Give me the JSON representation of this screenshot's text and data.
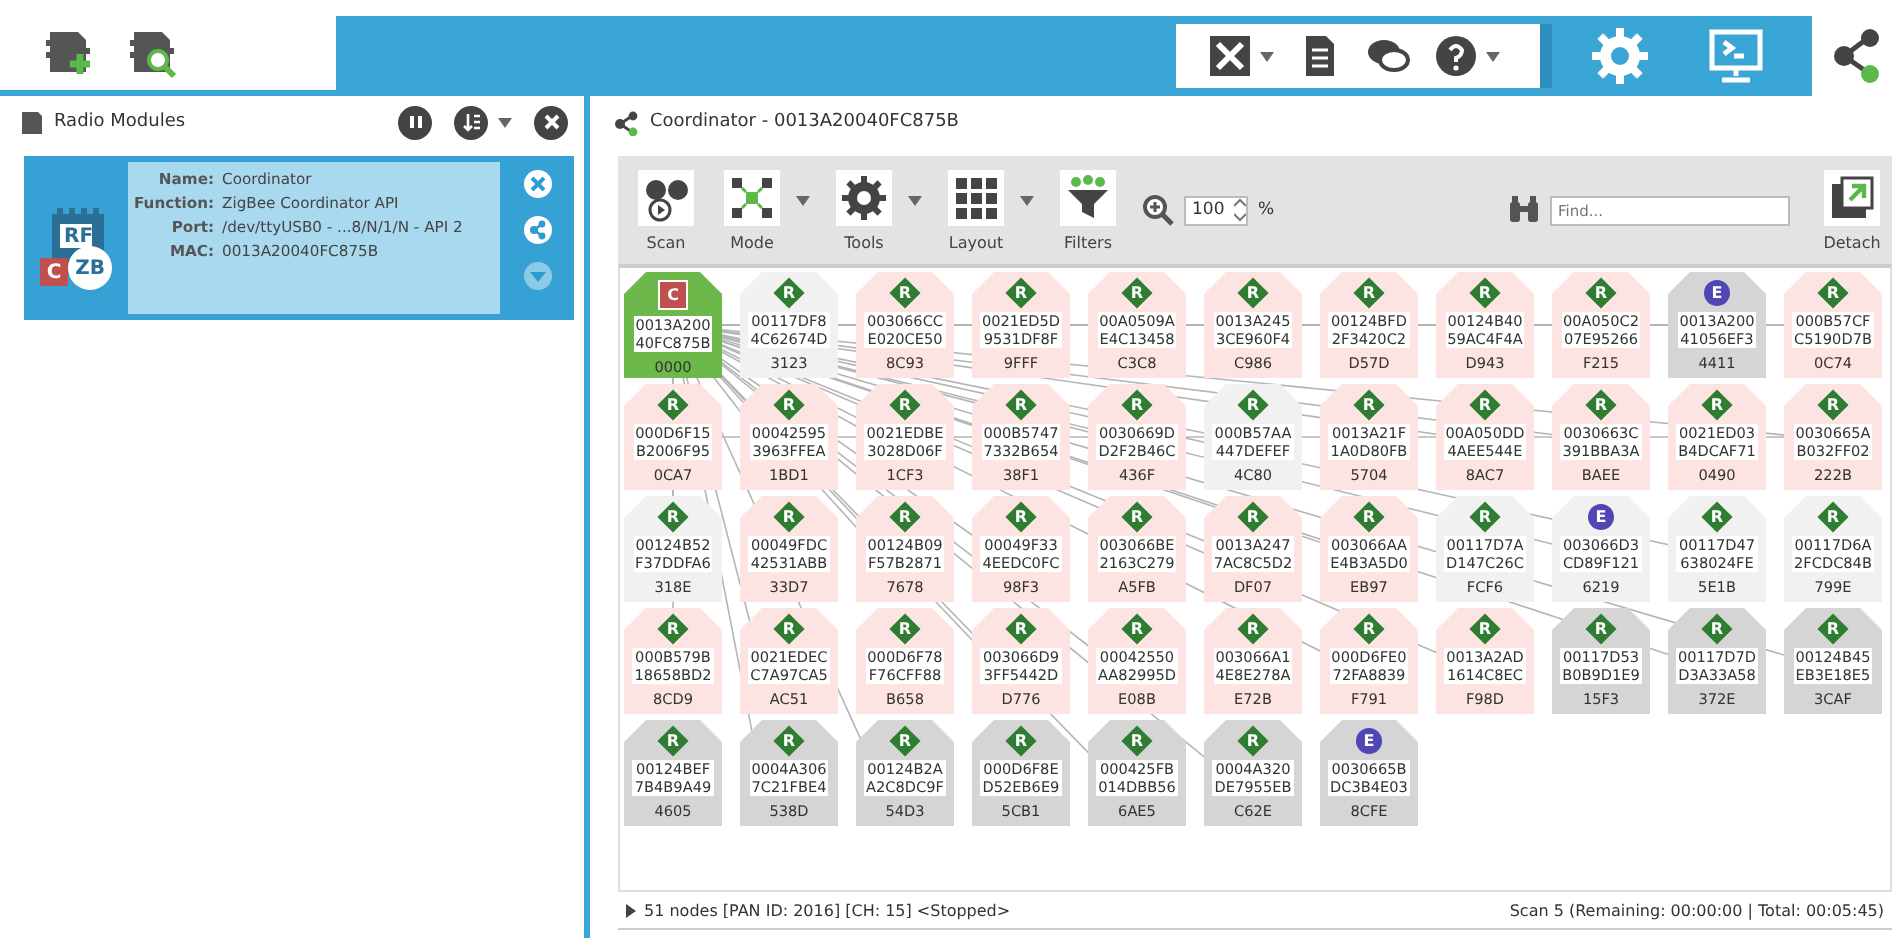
{
  "top_bar": {
    "module_buttons": [
      {
        "kind": "add"
      },
      {
        "kind": "discover"
      }
    ],
    "tools": [
      {
        "kind": "tools",
        "dropdown": true
      },
      {
        "kind": "document",
        "dropdown": false
      },
      {
        "kind": "chat",
        "dropdown": false
      },
      {
        "kind": "help",
        "dropdown": true
      }
    ],
    "modes": [
      {
        "kind": "configuration",
        "selected": false
      },
      {
        "kind": "console",
        "selected": false
      },
      {
        "kind": "network",
        "selected": true
      }
    ]
  },
  "radio_modules": {
    "title": "Radio Modules",
    "modules": [
      {
        "selected": true,
        "icon_text": "RF",
        "role": "C",
        "protocol": "ZB",
        "fields": [
          {
            "label": "Name:",
            "value": "Coordinator"
          },
          {
            "label": "Function:",
            "value": "ZigBee Coordinator API"
          },
          {
            "label": "Port:",
            "value": "/dev/ttyUSB0 - ...8/N/1/N - API 2"
          },
          {
            "label": "MAC:",
            "value": "0013A20040FC875B"
          }
        ],
        "actions": [
          {
            "kind": "close",
            "disabled": false
          },
          {
            "kind": "network",
            "disabled": false
          },
          {
            "kind": "expand",
            "disabled": true
          }
        ]
      }
    ]
  },
  "network": {
    "title": "Coordinator - 0013A20040FC875B",
    "toolbar": [
      {
        "kind": "scan",
        "label": "Scan",
        "dropdown": false
      },
      {
        "kind": "mode",
        "label": "Mode",
        "dropdown": true
      },
      {
        "kind": "tools",
        "label": "Tools",
        "dropdown": true
      },
      {
        "kind": "layout",
        "label": "Layout",
        "dropdown": true
      },
      {
        "kind": "filters",
        "label": "Filters",
        "dropdown": false
      }
    ],
    "zoom": {
      "value": "100",
      "unit": "%"
    },
    "find": {
      "placeholder": "Find..."
    },
    "detach": {
      "label": "Detach"
    },
    "nodes": [
      {
        "kind": "coordinator",
        "badge": "C",
        "addr": [
          "0013A200",
          "40FC875B"
        ],
        "short": "0000",
        "color": "#6cb84a"
      },
      {
        "kind": "router",
        "badge": "R",
        "addr": [
          "00117DF8",
          "4C62674D"
        ],
        "short": "3123",
        "color": "#f1f1f1"
      },
      {
        "kind": "router",
        "badge": "R",
        "addr": [
          "003066CC",
          "E020CE50"
        ],
        "short": "8C93",
        "color": "#fde3e1"
      },
      {
        "kind": "router",
        "badge": "R",
        "addr": [
          "0021ED5D",
          "9531DF8F"
        ],
        "short": "9FFF",
        "color": "#fde3e1"
      },
      {
        "kind": "router",
        "badge": "R",
        "addr": [
          "00A0509A",
          "E4C13458"
        ],
        "short": "C3C8",
        "color": "#fde3e1"
      },
      {
        "kind": "router",
        "badge": "R",
        "addr": [
          "0013A245",
          "3CE960F4"
        ],
        "short": "C986",
        "color": "#fde3e1"
      },
      {
        "kind": "router",
        "badge": "R",
        "addr": [
          "00124BFD",
          "2F3420C2"
        ],
        "short": "D57D",
        "color": "#fde3e1"
      },
      {
        "kind": "router",
        "badge": "R",
        "addr": [
          "00124B40",
          "59AC4F4A"
        ],
        "short": "D943",
        "color": "#fde3e1"
      },
      {
        "kind": "router",
        "badge": "R",
        "addr": [
          "00A050C2",
          "07E95266"
        ],
        "short": "F215",
        "color": "#fde3e1"
      },
      {
        "kind": "end_device",
        "badge": "E",
        "addr": [
          "0013A200",
          "41056EF3"
        ],
        "short": "4411",
        "color": "#d5d5d5"
      },
      {
        "kind": "router",
        "badge": "R",
        "addr": [
          "000B57CF",
          "C5190D7B"
        ],
        "short": "0C74",
        "color": "#fde3e1"
      },
      {
        "kind": "router",
        "badge": "R",
        "addr": [
          "000D6F15",
          "B2006F95"
        ],
        "short": "0CA7",
        "color": "#fde3e1"
      },
      {
        "kind": "router",
        "badge": "R",
        "addr": [
          "00042595",
          "3963FFEA"
        ],
        "short": "1BD1",
        "color": "#fde3e1"
      },
      {
        "kind": "router",
        "badge": "R",
        "addr": [
          "0021EDBE",
          "3028D06F"
        ],
        "short": "1CF3",
        "color": "#fde3e1"
      },
      {
        "kind": "router",
        "badge": "R",
        "addr": [
          "000B5747",
          "7332B654"
        ],
        "short": "38F1",
        "color": "#fde3e1"
      },
      {
        "kind": "router",
        "badge": "R",
        "addr": [
          "0030669D",
          "D2F2B46C"
        ],
        "short": "436F",
        "color": "#fde3e1"
      },
      {
        "kind": "router",
        "badge": "R",
        "addr": [
          "000B57AA",
          "447DEFEF"
        ],
        "short": "4C80",
        "color": "#f1f1f1"
      },
      {
        "kind": "router",
        "badge": "R",
        "addr": [
          "0013A21F",
          "1A0D80FB"
        ],
        "short": "5704",
        "color": "#fde3e1"
      },
      {
        "kind": "router",
        "badge": "R",
        "addr": [
          "00A050DD",
          "4AEE544E"
        ],
        "short": "8AC7",
        "color": "#fde3e1"
      },
      {
        "kind": "router",
        "badge": "R",
        "addr": [
          "0030663C",
          "391BBA3A"
        ],
        "short": "BAEE",
        "color": "#fde3e1"
      },
      {
        "kind": "router",
        "badge": "R",
        "addr": [
          "0021ED03",
          "B4DCAF71"
        ],
        "short": "0490",
        "color": "#fde3e1"
      },
      {
        "kind": "router",
        "badge": "R",
        "addr": [
          "0030665A",
          "B032FF02"
        ],
        "short": "222B",
        "color": "#fde3e1"
      },
      {
        "kind": "router",
        "badge": "R",
        "addr": [
          "00124B52",
          "F37DDFA6"
        ],
        "short": "318E",
        "color": "#f1f1f1"
      },
      {
        "kind": "router",
        "badge": "R",
        "addr": [
          "00049FDC",
          "42531ABB"
        ],
        "short": "33D7",
        "color": "#fde3e1"
      },
      {
        "kind": "router",
        "badge": "R",
        "addr": [
          "00124B09",
          "F57B2871"
        ],
        "short": "7678",
        "color": "#fde3e1"
      },
      {
        "kind": "router",
        "badge": "R",
        "addr": [
          "00049F33",
          "4EEDC0FC"
        ],
        "short": "98F3",
        "color": "#fde3e1"
      },
      {
        "kind": "router",
        "badge": "R",
        "addr": [
          "003066BE",
          "2163C279"
        ],
        "short": "A5FB",
        "color": "#fde3e1"
      },
      {
        "kind": "router",
        "badge": "R",
        "addr": [
          "0013A247",
          "7AC8C5D2"
        ],
        "short": "DF07",
        "color": "#fde3e1"
      },
      {
        "kind": "router",
        "badge": "R",
        "addr": [
          "003066AA",
          "E4B3A5D0"
        ],
        "short": "EB97",
        "color": "#fde3e1"
      },
      {
        "kind": "router",
        "badge": "R",
        "addr": [
          "00117D7A",
          "D147C26C"
        ],
        "short": "FCF6",
        "color": "#f1f1f1"
      },
      {
        "kind": "end_device",
        "badge": "E",
        "addr": [
          "003066D3",
          "CD89F121"
        ],
        "short": "6219",
        "color": "#f1f1f1"
      },
      {
        "kind": "router",
        "badge": "R",
        "addr": [
          "00117D47",
          "638024FE"
        ],
        "short": "5E1B",
        "color": "#f1f1f1"
      },
      {
        "kind": "router",
        "badge": "R",
        "addr": [
          "00117D6A",
          "2FCDC84B"
        ],
        "short": "799E",
        "color": "#f1f1f1"
      },
      {
        "kind": "router",
        "badge": "R",
        "addr": [
          "000B579B",
          "18658BD2"
        ],
        "short": "8CD9",
        "color": "#fde3e1"
      },
      {
        "kind": "router",
        "badge": "R",
        "addr": [
          "0021EDEC",
          "C7A97CA5"
        ],
        "short": "AC51",
        "color": "#fde3e1"
      },
      {
        "kind": "router",
        "badge": "R",
        "addr": [
          "000D6F78",
          "F76CFF88"
        ],
        "short": "B658",
        "color": "#fde3e1"
      },
      {
        "kind": "router",
        "badge": "R",
        "addr": [
          "003066D9",
          "3FF5442D"
        ],
        "short": "D776",
        "color": "#fde3e1"
      },
      {
        "kind": "router",
        "badge": "R",
        "addr": [
          "00042550",
          "AA82995D"
        ],
        "short": "E08B",
        "color": "#fde3e1"
      },
      {
        "kind": "router",
        "badge": "R",
        "addr": [
          "003066A1",
          "4E8E278A"
        ],
        "short": "E72B",
        "color": "#fde3e1"
      },
      {
        "kind": "router",
        "badge": "R",
        "addr": [
          "000D6FE0",
          "72FA8839"
        ],
        "short": "F791",
        "color": "#fde3e1"
      },
      {
        "kind": "router",
        "badge": "R",
        "addr": [
          "0013A2AD",
          "1614C8EC"
        ],
        "short": "F98D",
        "color": "#fde3e1"
      },
      {
        "kind": "router",
        "badge": "R",
        "addr": [
          "00117D53",
          "B0B9D1E9"
        ],
        "short": "15F3",
        "color": "#d5d5d5"
      },
      {
        "kind": "router",
        "badge": "R",
        "addr": [
          "00117D7D",
          "D3A33A58"
        ],
        "short": "372E",
        "color": "#d5d5d5"
      },
      {
        "kind": "router",
        "badge": "R",
        "addr": [
          "00124B45",
          "EB3E18E5"
        ],
        "short": "3CAF",
        "color": "#d5d5d5"
      },
      {
        "kind": "router",
        "badge": "R",
        "addr": [
          "00124BEF",
          "7B4B9A49"
        ],
        "short": "4605",
        "color": "#d5d5d5"
      },
      {
        "kind": "router",
        "badge": "R",
        "addr": [
          "0004A306",
          "7C21FBE4"
        ],
        "short": "538D",
        "color": "#d5d5d5"
      },
      {
        "kind": "router",
        "badge": "R",
        "addr": [
          "00124B2A",
          "A2C8DC9F"
        ],
        "short": "54D3",
        "color": "#d5d5d5"
      },
      {
        "kind": "router",
        "badge": "R",
        "addr": [
          "000D6F8E",
          "D52EB6E9"
        ],
        "short": "5CB1",
        "color": "#d5d5d5"
      },
      {
        "kind": "router",
        "badge": "R",
        "addr": [
          "000425FB",
          "014DBB56"
        ],
        "short": "6AE5",
        "color": "#d5d5d5"
      },
      {
        "kind": "router",
        "badge": "R",
        "addr": [
          "0004A320",
          "DE7955EB"
        ],
        "short": "C62E",
        "color": "#d5d5d5"
      },
      {
        "kind": "end_device",
        "badge": "E",
        "addr": [
          "0030665B",
          "DC3B4E03"
        ],
        "short": "8CFE",
        "color": "#d5d5d5"
      }
    ],
    "status": {
      "summary": "51 nodes [PAN ID: 2016] [CH: 15] <Stopped>",
      "scan": "Scan 5 (Remaining: 00:00:00 | Total: 00:05:45)"
    }
  }
}
